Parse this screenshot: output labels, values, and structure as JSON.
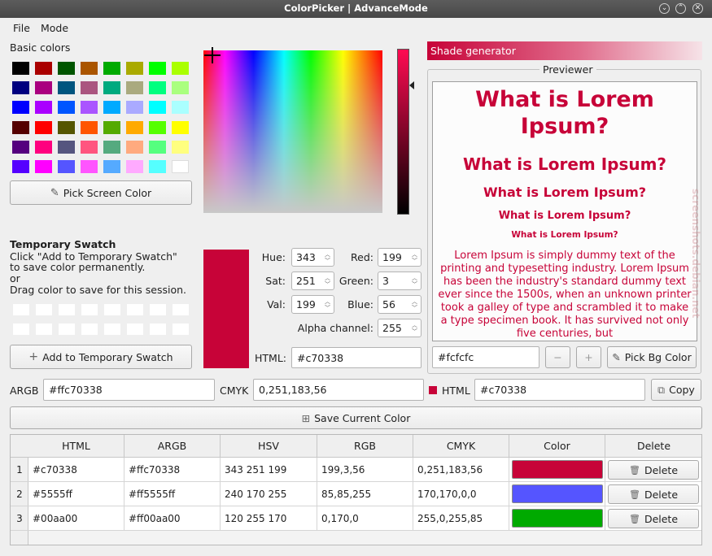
{
  "window": {
    "title": "ColorPicker | AdvanceMode"
  },
  "menu": {
    "file": "File",
    "mode": "Mode"
  },
  "basic_colors": {
    "label": "Basic colors",
    "swatches": [
      [
        "#000000",
        "#aa0000",
        "#005500",
        "#aa5500",
        "#00aa00",
        "#aaaa00",
        "#00ff00",
        "#aaff00"
      ],
      [
        "#00007f",
        "#aa007f",
        "#00557f",
        "#aa557f",
        "#00aa7f",
        "#aaaa7f",
        "#00ff7f",
        "#aaff7f"
      ],
      [
        "#0000ff",
        "#aa00ff",
        "#0055ff",
        "#aa55ff",
        "#00aaff",
        "#aaaaff",
        "#00ffff",
        "#aaffff"
      ],
      [
        "#550000",
        "#ff0000",
        "#555500",
        "#ff5500",
        "#55aa00",
        "#ffaa00",
        "#55ff00",
        "#ffff00"
      ],
      [
        "#55007f",
        "#ff007f",
        "#55557f",
        "#ff557f",
        "#55aa7f",
        "#ffaa7f",
        "#55ff7f",
        "#ffff7f"
      ],
      [
        "#5500ff",
        "#ff00ff",
        "#5555ff",
        "#ff55ff",
        "#55aaff",
        "#ffaaff",
        "#55ffff",
        "#ffffff"
      ]
    ]
  },
  "pick_screen": {
    "label": "Pick Screen Color"
  },
  "temp_swatch": {
    "title": "Temporary Swatch",
    "line1": "Click \"Add to Temporary Swatch\"",
    "line2": "to save color permanently.",
    "line3": "or",
    "line4": "Drag color to save for this session.",
    "add_label": "Add to Temporary Swatch"
  },
  "current_color": "#c70338",
  "values": {
    "hue_label": "Hue:",
    "hue": "343",
    "sat_label": "Sat:",
    "sat": "251",
    "val_label": "Val:",
    "val": "199",
    "red_label": "Red:",
    "red": "199",
    "green_label": "Green:",
    "green": "3",
    "blue_label": "Blue:",
    "blue": "56",
    "alpha_label": "Alpha channel:",
    "alpha": "255",
    "html_label": "HTML:",
    "html": "#c70338"
  },
  "shade_generator": {
    "label": "Shade generator"
  },
  "previewer": {
    "label": "Previewer",
    "h1": "What is Lorem Ipsum?",
    "h2": "What is Lorem Ipsum?",
    "h3": "What is Lorem Ipsum?",
    "h4": "What is Lorem Ipsum?",
    "h5": "What is Lorem Ipsum?",
    "body": "Lorem Ipsum is simply dummy text of the printing and typesetting industry. Lorem Ipsum has been the industry's standard dummy text ever since the 1500s, when an unknown printer took a galley of type and scrambled it to make a type specimen book. It has survived not only five centuries, but",
    "text_color": "#c70338",
    "bg_value": "#fcfcfc",
    "minus": "−",
    "plus": "+",
    "pick_bg_label": "Pick Bg Color"
  },
  "formats": {
    "argb_label": "ARGB",
    "argb": "#ffc70338",
    "cmyk_label": "CMYK",
    "cmyk": "0,251,183,56",
    "html_label": "HTML",
    "html": "#c70338",
    "copy_label": "Copy"
  },
  "save_label": "Save Current Color",
  "table": {
    "headers": [
      "HTML",
      "ARGB",
      "HSV",
      "RGB",
      "CMYK",
      "Color",
      "Delete"
    ],
    "rows": [
      {
        "num": "1",
        "html": "#c70338",
        "argb": "#ffc70338",
        "hsv": "343 251 199",
        "rgb": "199,3,56",
        "cmyk": "0,251,183,56",
        "color": "#c70338",
        "delete": "Delete"
      },
      {
        "num": "2",
        "html": "#5555ff",
        "argb": "#ff5555ff",
        "hsv": "240 170 255",
        "rgb": "85,85,255",
        "cmyk": "170,170,0,0",
        "color": "#5555ff",
        "delete": "Delete"
      },
      {
        "num": "3",
        "html": "#00aa00",
        "argb": "#ff00aa00",
        "hsv": "120 255 170",
        "rgb": "0,170,0",
        "cmyk": "255,0,255,85",
        "color": "#00aa00",
        "delete": "Delete"
      }
    ]
  },
  "watermark": "screenshots.debian.net"
}
